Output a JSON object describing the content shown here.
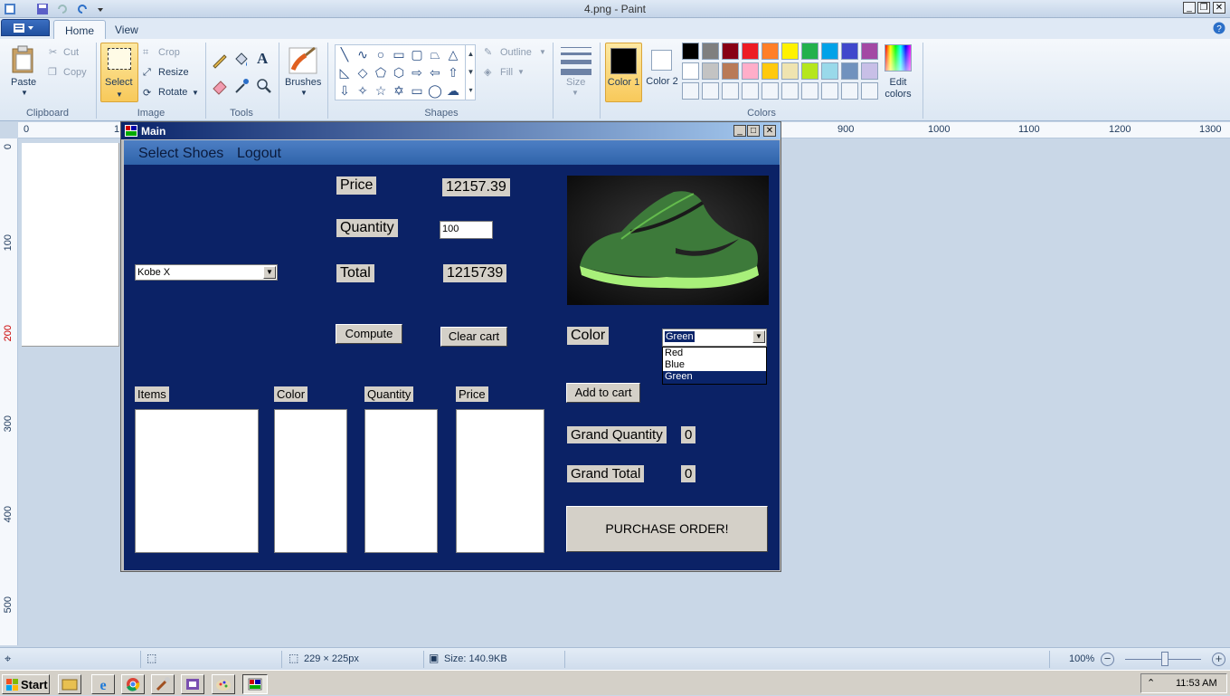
{
  "window": {
    "title": "4.png - Paint"
  },
  "ribbon": {
    "tabs": [
      "Home",
      "View"
    ],
    "clipboard": {
      "label": "Clipboard",
      "paste": "Paste",
      "cut": "Cut",
      "copy": "Copy"
    },
    "image": {
      "label": "Image",
      "select": "Select",
      "crop": "Crop",
      "resize": "Resize",
      "rotate": "Rotate"
    },
    "tools": {
      "label": "Tools"
    },
    "brushes": {
      "label": "Brushes"
    },
    "shapes": {
      "label": "Shapes",
      "outline": "Outline",
      "fill": "Fill"
    },
    "size": {
      "label": "Size"
    },
    "colors": {
      "label": "Colors",
      "color1": "Color 1",
      "color2": "Color 2",
      "edit": "Edit colors",
      "row1": [
        "#000000",
        "#7f7f7f",
        "#880015",
        "#ed1c24",
        "#ff7f27",
        "#fff200",
        "#22b14c",
        "#00a2e8",
        "#3f48cc",
        "#a349a4"
      ],
      "row2": [
        "#ffffff",
        "#c3c3c3",
        "#b97a57",
        "#ffaec9",
        "#ffc90e",
        "#efe4b0",
        "#b5e61d",
        "#99d9ea",
        "#7092be",
        "#c8bfe7"
      ]
    }
  },
  "rulers": {
    "h": [
      "0",
      "1",
      "900",
      "1000",
      "1100",
      "1200",
      "1300"
    ],
    "v": [
      "0",
      "100",
      "200",
      "300",
      "400",
      "500"
    ]
  },
  "form": {
    "title": "Main",
    "menu": [
      "Select Shoes",
      "Logout"
    ],
    "product_select": "Kobe X",
    "price_label": "Price",
    "price_value": "12157.39",
    "quantity_label": "Quantity",
    "quantity_value": "100",
    "total_label": "Total",
    "total_value": "1215739",
    "compute": "Compute",
    "clear_cart": "Clear cart",
    "color_label": "Color",
    "color_selected": "Green",
    "color_options": [
      "Red",
      "Blue",
      "Green"
    ],
    "add_to_cart": "Add to cart",
    "columns": [
      "Items",
      "Color",
      "Quantity",
      "Price"
    ],
    "grand_quantity_label": "Grand Quantity",
    "grand_quantity_value": "0",
    "grand_total_label": "Grand Total",
    "grand_total_value": "0",
    "purchase": "PURCHASE ORDER!"
  },
  "status": {
    "dimensions": "229 × 225px",
    "size": "Size: 140.9KB",
    "zoom": "100%"
  },
  "taskbar": {
    "start": "Start",
    "clock": "11:53 AM"
  }
}
